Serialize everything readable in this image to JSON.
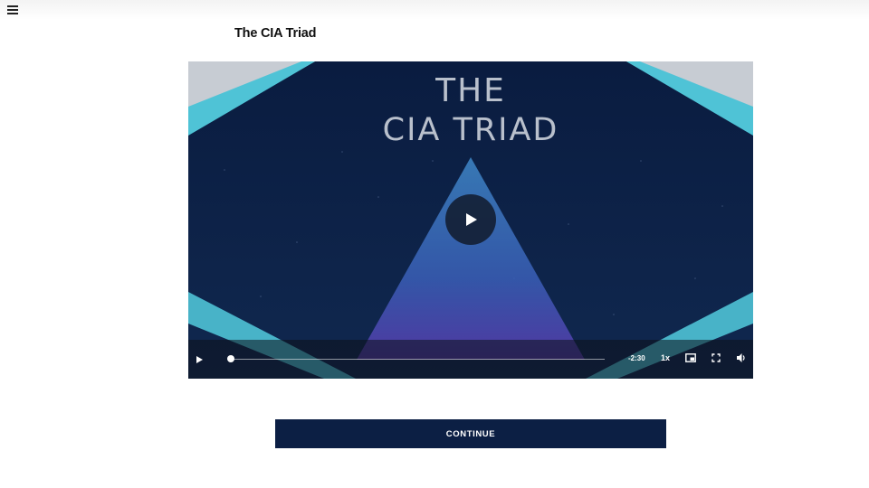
{
  "header": {
    "menu_icon": "hamburger-menu-icon"
  },
  "lesson": {
    "title": "The CIA Triad"
  },
  "video": {
    "title_line1": "THE",
    "title_line2": "CIA TRIAD",
    "progress_fraction": 0.0,
    "time_remaining": "-2:30",
    "speed": "1x",
    "icons": {
      "big_play": "play-icon",
      "play": "play-icon",
      "pip": "picture-in-picture-icon",
      "fullscreen": "fullscreen-icon",
      "volume": "volume-icon"
    },
    "colors": {
      "background": "#0b1f45",
      "triangle": "#3b78c4",
      "accent_teal": "#4fc3d6"
    }
  },
  "actions": {
    "continue_label": "CONTINUE"
  },
  "colors": {
    "primary_button": "#0c1f44"
  }
}
